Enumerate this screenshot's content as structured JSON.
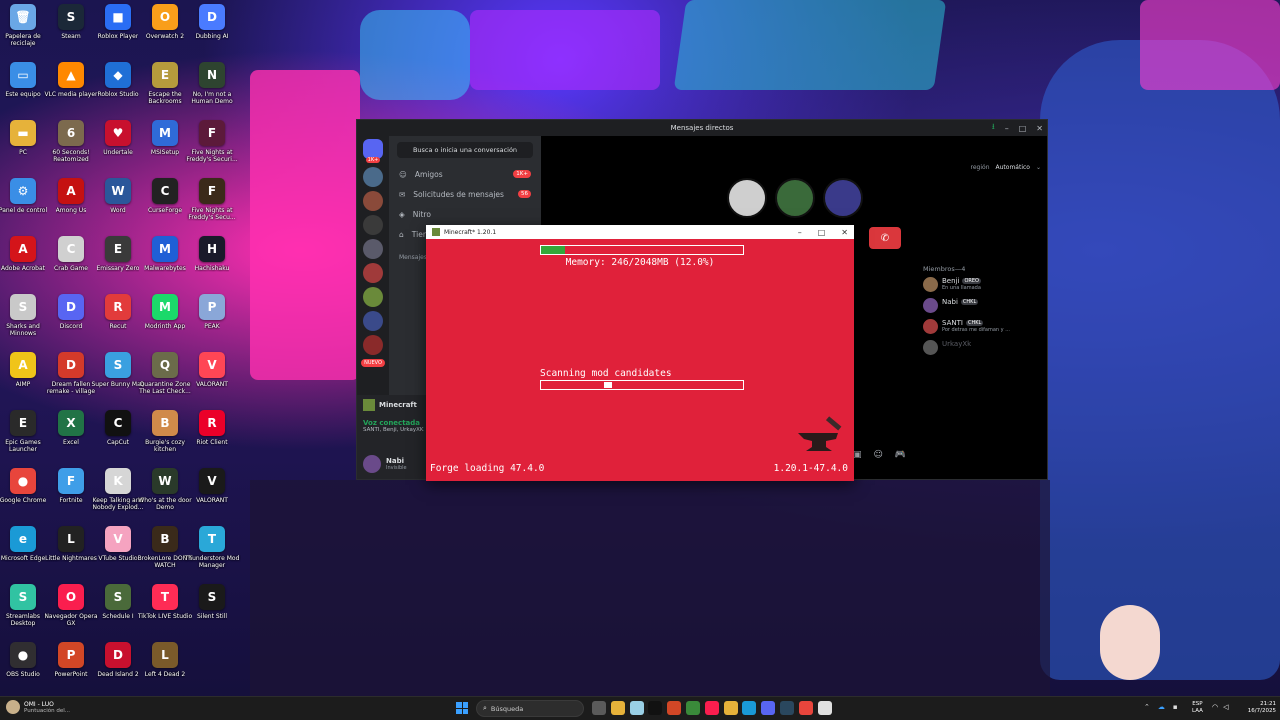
{
  "desktop": {
    "icons": [
      {
        "label": "Papelera de reciclaje",
        "color": "#6aa7e6",
        "glyph": "🗑"
      },
      {
        "label": "Steam",
        "color": "#1b2838",
        "glyph": "S"
      },
      {
        "label": "Roblox Player",
        "color": "#2a6df4",
        "glyph": "■"
      },
      {
        "label": "Overwatch 2",
        "color": "#f99e1a",
        "glyph": "O"
      },
      {
        "label": "Dubbing AI",
        "color": "#4a7bff",
        "glyph": "D"
      },
      {
        "label": "Este equipo",
        "color": "#3a8ee6",
        "glyph": "▭"
      },
      {
        "label": "VLC media player",
        "color": "#ff8800",
        "glyph": "▲"
      },
      {
        "label": "Roblox Studio",
        "color": "#1f6fd6",
        "glyph": "◆"
      },
      {
        "label": "Escape the Backrooms",
        "color": "#b59b3c",
        "glyph": "E"
      },
      {
        "label": "No, I'm not a Human Demo",
        "color": "#2e4430",
        "glyph": "N"
      },
      {
        "label": "PC",
        "color": "#e6b23a",
        "glyph": "▬"
      },
      {
        "label": "60 Seconds! Reatomized",
        "color": "#7c6a4e",
        "glyph": "6"
      },
      {
        "label": "Undertale",
        "color": "#c8102e",
        "glyph": "♥"
      },
      {
        "label": "MSISetup",
        "color": "#2f6bd8",
        "glyph": "M"
      },
      {
        "label": "Five Nights at Freddy's Securi...",
        "color": "#5c1a3a",
        "glyph": "F"
      },
      {
        "label": "Panel de control",
        "color": "#3a8ee6",
        "glyph": "⚙"
      },
      {
        "label": "Among Us",
        "color": "#c51111",
        "glyph": "A"
      },
      {
        "label": "Word",
        "color": "#2b579a",
        "glyph": "W"
      },
      {
        "label": "CurseForge",
        "color": "#222222",
        "glyph": "C"
      },
      {
        "label": "Five Nights at Freddy's Secu...",
        "color": "#3b2a1a",
        "glyph": "F"
      },
      {
        "label": "Adobe Acrobat",
        "color": "#d4141a",
        "glyph": "A"
      },
      {
        "label": "Crab Game",
        "color": "#d0d0d0",
        "glyph": "C"
      },
      {
        "label": "Emissary Zero",
        "color": "#3a3a3a",
        "glyph": "E"
      },
      {
        "label": "Malwarebytes",
        "color": "#1f5fd6",
        "glyph": "M"
      },
      {
        "label": "Hachishaku",
        "color": "#1a1a2a",
        "glyph": "H"
      },
      {
        "label": "Sharks and Minnows",
        "color": "#c9c9c9",
        "glyph": "S"
      },
      {
        "label": "Discord",
        "color": "#5865f2",
        "glyph": "D"
      },
      {
        "label": "Recut",
        "color": "#e23b3b",
        "glyph": "R"
      },
      {
        "label": "Modrinth App",
        "color": "#1bd96a",
        "glyph": "M"
      },
      {
        "label": "PEAK",
        "color": "#8aa7d8",
        "glyph": "P"
      },
      {
        "label": "AIMP",
        "color": "#f0c419",
        "glyph": "A"
      },
      {
        "label": "Dream fallen remake - village",
        "color": "#d43a2a",
        "glyph": "D"
      },
      {
        "label": "Super Bunny Man",
        "color": "#3aa0e0",
        "glyph": "S"
      },
      {
        "label": "Quarantine Zone The Last Check...",
        "color": "#6b6b4a",
        "glyph": "Q"
      },
      {
        "label": "VALORANT",
        "color": "#ff4655",
        "glyph": "V"
      },
      {
        "label": "Epic Games Launcher",
        "color": "#2a2a2a",
        "glyph": "E"
      },
      {
        "label": "Excel",
        "color": "#217346",
        "glyph": "X"
      },
      {
        "label": "CapCut",
        "color": "#111111",
        "glyph": "C"
      },
      {
        "label": "Burgie's cozy kitchen",
        "color": "#d08a4a",
        "glyph": "B"
      },
      {
        "label": "Riot Client",
        "color": "#eb0029",
        "glyph": "R"
      },
      {
        "label": "Google Chrome",
        "color": "#e8453c",
        "glyph": "●"
      },
      {
        "label": "Fortnite",
        "color": "#3f9ee8",
        "glyph": "F"
      },
      {
        "label": "Keep Talking and Nobody Explod...",
        "color": "#d6d6d6",
        "glyph": "K"
      },
      {
        "label": "Who's at the door Demo",
        "color": "#2a3a2a",
        "glyph": "W"
      },
      {
        "label": "VALORANT",
        "color": "#1a1a1a",
        "glyph": "V"
      },
      {
        "label": "Microsoft Edge",
        "color": "#1a9ad6",
        "glyph": "e"
      },
      {
        "label": "Little Nightmares",
        "color": "#222222",
        "glyph": "L"
      },
      {
        "label": "VTube Studio",
        "color": "#f5a3c0",
        "glyph": "V"
      },
      {
        "label": "BrokenLore DON'T WATCH",
        "color": "#3a2a1a",
        "glyph": "B"
      },
      {
        "label": "Thunderstore Mod Manager",
        "color": "#2aa8d8",
        "glyph": "T"
      },
      {
        "label": "Streamlabs Desktop",
        "color": "#31c3a2",
        "glyph": "S"
      },
      {
        "label": "Navegador Opera GX",
        "color": "#fa1e4e",
        "glyph": "O"
      },
      {
        "label": "Schedule I",
        "color": "#4a6a3a",
        "glyph": "S"
      },
      {
        "label": "TikTok LIVE Studio",
        "color": "#fe2c55",
        "glyph": "T"
      },
      {
        "label": "Silent Still",
        "color": "#1a1a1a",
        "glyph": "S"
      },
      {
        "label": "OBS Studio",
        "color": "#302e31",
        "glyph": "●"
      },
      {
        "label": "PowerPoint",
        "color": "#d24726",
        "glyph": "P"
      },
      {
        "label": "Dead Island 2",
        "color": "#c8102e",
        "glyph": "D"
      },
      {
        "label": "Left 4 Dead 2",
        "color": "#7a5a2a",
        "glyph": "L"
      }
    ]
  },
  "discord": {
    "title": "Mensajes directos",
    "search_label": "Busca o inicia una conversación",
    "nav": [
      {
        "label": "Amigos",
        "badge": "1K+"
      },
      {
        "label": "Solicitudes de mensajes",
        "badge": "56"
      },
      {
        "label": "Nitro",
        "badge": ""
      },
      {
        "label": "Tienda",
        "badge": ""
      }
    ],
    "rail_badge": "1K+",
    "new_badge": "NUEVO",
    "dm_header": "Mensajes directos",
    "active_game": "Minecraft",
    "voice_status": "Voz conectada",
    "voice_members": "SANTI, Benji, UrkayXK",
    "user_name": "Nabi",
    "user_status": "Invisible",
    "region_label": "región",
    "region_value": "Automático",
    "members_header": "Miembros—4",
    "members": [
      {
        "name": "Benji",
        "tag": "OREO",
        "status": "En una llamada",
        "color": "#8a6a4a"
      },
      {
        "name": "Nabi",
        "tag": "CHKL",
        "status": "",
        "color": "#6a4a8a"
      },
      {
        "name": "SANTI",
        "tag": "CHKL",
        "status": "Por detras me difaman y ...",
        "color": "#a03a3a"
      },
      {
        "name": "UrkayXk",
        "tag": "",
        "status": "",
        "color": "#555555"
      }
    ],
    "call_avatar_colors": [
      "#cfcfcf",
      "#3a6a3a",
      "#3a3a8a"
    ]
  },
  "minecraft": {
    "title": "Minecraft* 1.20.1",
    "memory_text": "Memory: 246/2048MB (12.0%)",
    "memory_fraction": 0.12,
    "scan_text": "Scanning mod candidates",
    "scan_fraction": 0.32,
    "forge_text": "Forge loading 47.4.0",
    "version_text": "1.20.1-47.4.0",
    "bg_color": "#e0213a"
  },
  "taskbar": {
    "search_placeholder": "Búsqueda",
    "notif_title": "OMI - LUO",
    "notif_sub": "Puntuación del...",
    "lang_top": "ESP",
    "lang_bottom": "LAA",
    "time": "21:21",
    "date": "16/7/2025"
  }
}
